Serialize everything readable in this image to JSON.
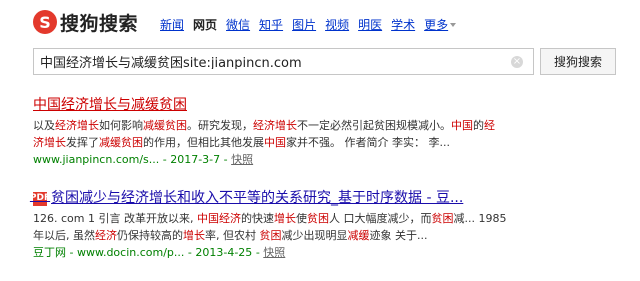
{
  "logo": {
    "mark": "S",
    "text": "搜狗搜索"
  },
  "nav": {
    "items": [
      "新闻",
      "网页",
      "微信",
      "知乎",
      "图片",
      "视频",
      "明医",
      "学术"
    ],
    "active": "网页",
    "more": "更多"
  },
  "search": {
    "query": "中国经济增长与减缓贫困site:jianpincn.com",
    "clear": "×",
    "button": "搜狗搜索"
  },
  "results": [
    {
      "title": "中国经济增长与减缓贫困",
      "snippet1": [
        {
          "t": "以及",
          "h": false
        },
        {
          "t": "经济增长",
          "h": true
        },
        {
          "t": "如何影响",
          "h": false
        },
        {
          "t": "减缓贫困",
          "h": true
        },
        {
          "t": "。研究发现，",
          "h": false
        },
        {
          "t": "经济增长",
          "h": true
        },
        {
          "t": "不一定必然引起贫困规模减小。",
          "h": false
        },
        {
          "t": "中国",
          "h": true
        },
        {
          "t": "的",
          "h": false
        },
        {
          "t": "经",
          "h": true
        }
      ],
      "snippet2": [
        {
          "t": "济增长",
          "h": true
        },
        {
          "t": "发挥了",
          "h": false
        },
        {
          "t": "减缓贫困",
          "h": true
        },
        {
          "t": "的作用，但相比其他发展",
          "h": false
        },
        {
          "t": "中国",
          "h": true
        },
        {
          "t": "家并不强。 作者简介 李实： 李...",
          "h": false
        }
      ],
      "url": "www.jianpincn.com/s...",
      "date": "2017-3-7",
      "snapshot": "快照"
    },
    {
      "icon": "PDF",
      "title": "贫困减少与经济增长和收入不平等的关系研究_基于时序数据 - 豆...",
      "snippet1": [
        {
          "t": "126. com 1 引言 改革开放以来, ",
          "h": false
        },
        {
          "t": "中国经济",
          "h": true
        },
        {
          "t": "的快速",
          "h": false
        },
        {
          "t": "增长",
          "h": true
        },
        {
          "t": "使",
          "h": false
        },
        {
          "t": "贫困",
          "h": true
        },
        {
          "t": "人 口大幅度减少，而",
          "h": false
        },
        {
          "t": "贫困",
          "h": true
        },
        {
          "t": "减... 1985",
          "h": false
        }
      ],
      "snippet2": [
        {
          "t": "年以后, 虽然",
          "h": false
        },
        {
          "t": "经济",
          "h": true
        },
        {
          "t": "仍保持较高的",
          "h": false
        },
        {
          "t": "增长",
          "h": true
        },
        {
          "t": "率, 但农村 ",
          "h": false
        },
        {
          "t": "贫困",
          "h": true
        },
        {
          "t": "减少出现明显",
          "h": false
        },
        {
          "t": "减缓",
          "h": true
        },
        {
          "t": "迹象 关于...",
          "h": false
        }
      ],
      "url": "豆丁网 - www.docin.com/p...",
      "date": "2013-4-25",
      "snapshot": "快照"
    }
  ]
}
